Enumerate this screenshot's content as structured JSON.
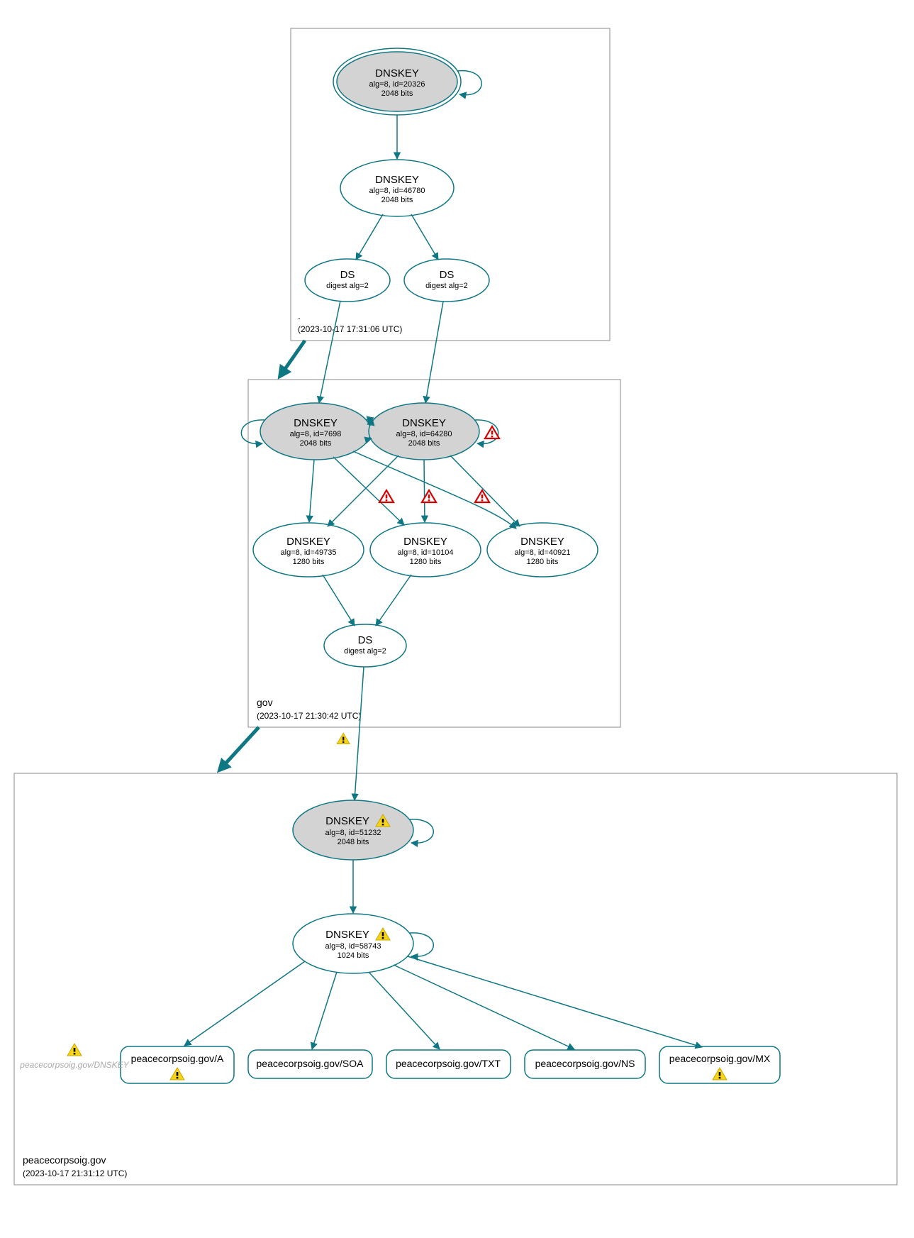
{
  "zones": {
    "root": {
      "name": ".",
      "timestamp": "(2023-10-17 17:31:06 UTC)"
    },
    "gov": {
      "name": "gov",
      "timestamp": "(2023-10-17 21:30:42 UTC)"
    },
    "domain": {
      "name": "peacecorpsoig.gov",
      "timestamp": "(2023-10-17 21:31:12 UTC)"
    }
  },
  "nodes": {
    "root_ksk": {
      "title": "DNSKEY",
      "line2": "alg=8, id=20326",
      "line3": "2048 bits"
    },
    "root_zsk": {
      "title": "DNSKEY",
      "line2": "alg=8, id=46780",
      "line3": "2048 bits"
    },
    "root_ds1": {
      "title": "DS",
      "line2": "digest alg=2"
    },
    "root_ds2": {
      "title": "DS",
      "line2": "digest alg=2"
    },
    "gov_k1": {
      "title": "DNSKEY",
      "line2": "alg=8, id=7698",
      "line3": "2048 bits"
    },
    "gov_k2": {
      "title": "DNSKEY",
      "line2": "alg=8, id=64280",
      "line3": "2048 bits"
    },
    "gov_k3": {
      "title": "DNSKEY",
      "line2": "alg=8, id=49735",
      "line3": "1280 bits"
    },
    "gov_k4": {
      "title": "DNSKEY",
      "line2": "alg=8, id=10104",
      "line3": "1280 bits"
    },
    "gov_k5": {
      "title": "DNSKEY",
      "line2": "alg=8, id=40921",
      "line3": "1280 bits"
    },
    "gov_ds": {
      "title": "DS",
      "line2": "digest alg=2"
    },
    "dom_ksk": {
      "title": "DNSKEY",
      "line2": "alg=8, id=51232",
      "line3": "2048 bits"
    },
    "dom_zsk": {
      "title": "DNSKEY",
      "line2": "alg=8, id=58743",
      "line3": "1024 bits"
    },
    "rr_a": {
      "label": "peacecorpsoig.gov/A"
    },
    "rr_soa": {
      "label": "peacecorpsoig.gov/SOA"
    },
    "rr_txt": {
      "label": "peacecorpsoig.gov/TXT"
    },
    "rr_ns": {
      "label": "peacecorpsoig.gov/NS"
    },
    "rr_mx": {
      "label": "peacecorpsoig.gov/MX"
    },
    "rr_dnskey": {
      "label": "peacecorpsoig.gov/DNSKEY"
    }
  }
}
